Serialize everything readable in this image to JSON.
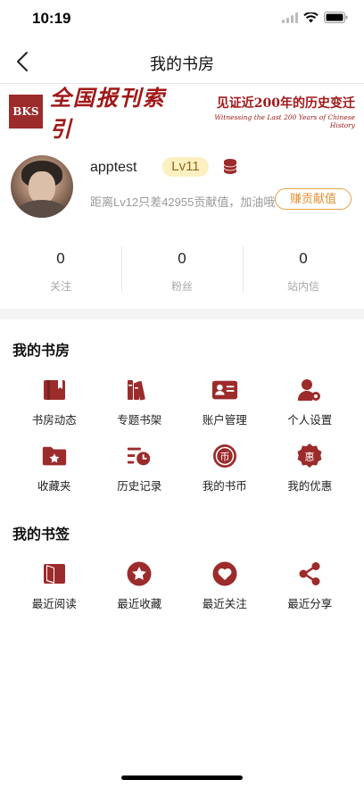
{
  "status_bar": {
    "time": "10:19"
  },
  "nav": {
    "title": "我的书房"
  },
  "banner": {
    "logo_text": "BKS",
    "name": "全国报刊索引",
    "slogan": "见证近200年的历史变迁",
    "subtitle": "Witnessing the Last 200 Years of Chinese History"
  },
  "profile": {
    "username": "apptest",
    "level": "Lv11",
    "progress_text": "距离Lv12只差42955贡献值，加油哦",
    "earn_button": "赚贡献值"
  },
  "stats": [
    {
      "value": "0",
      "label": "关注"
    },
    {
      "value": "0",
      "label": "粉丝"
    },
    {
      "value": "0",
      "label": "站内信"
    }
  ],
  "my_study": {
    "title": "我的书房",
    "items": [
      {
        "label": "书房动态",
        "icon": "study-feed-icon"
      },
      {
        "label": "专题书架",
        "icon": "bookshelf-icon"
      },
      {
        "label": "账户管理",
        "icon": "id-card-icon"
      },
      {
        "label": "个人设置",
        "icon": "user-settings-icon"
      },
      {
        "label": "收藏夹",
        "icon": "folder-star-icon"
      },
      {
        "label": "历史记录",
        "icon": "history-icon"
      },
      {
        "label": "我的书币",
        "icon": "coin-icon"
      },
      {
        "label": "我的优惠",
        "icon": "discount-badge-icon"
      }
    ]
  },
  "my_bookmarks": {
    "title": "我的书签",
    "items": [
      {
        "label": "最近阅读",
        "icon": "open-book-icon"
      },
      {
        "label": "最近收藏",
        "icon": "star-circle-icon"
      },
      {
        "label": "最近关注",
        "icon": "heart-circle-icon"
      },
      {
        "label": "最近分享",
        "icon": "share-icon"
      }
    ]
  },
  "colors": {
    "accent": "#9c2b2b",
    "gold": "#e29236",
    "level_bg": "#fdf0c0"
  }
}
